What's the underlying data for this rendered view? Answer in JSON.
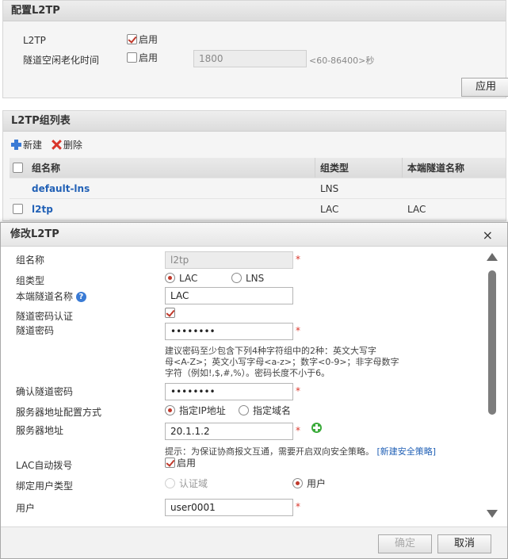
{
  "config": {
    "title": "配置L2TP",
    "l2tp_label": "L2TP",
    "l2tp_enable": "启用",
    "idle_label": "隧道空闲老化时间",
    "idle_enable": "启用",
    "idle_value": "1800",
    "idle_hint": "<60-86400>秒",
    "apply": "应用"
  },
  "group_list": {
    "title": "L2TP组列表",
    "new": "新建",
    "delete": "删除",
    "columns": [
      "组名称",
      "组类型",
      "本端隧道名称"
    ],
    "rows": [
      {
        "name": "default-lns",
        "type": "LNS",
        "tunnel": ""
      },
      {
        "name": "l2tp",
        "type": "LAC",
        "tunnel": "LAC"
      }
    ]
  },
  "dialog": {
    "title": "修改L2TP",
    "close": "×",
    "group_name_label": "组名称",
    "group_name_value": "l2tp",
    "group_type_label": "组类型",
    "type_lac": "LAC",
    "type_lns": "LNS",
    "tunnel_name_label": "本端隧道名称",
    "tunnel_name_value": "LAC",
    "auth_label": "隧道密码认证",
    "password_label": "隧道密码",
    "password_value": "••••••••",
    "password_note_1": "建议密码至少包含下列4种字符组中的2种：英文大写字",
    "password_note_2": "母<A-Z>；英文小写字母<a-z>；数字<0-9>；非字母数字",
    "password_note_3": "字符（例如!,$,#,%）。密码长度不小于6。",
    "confirm_label": "确认隧道密码",
    "confirm_value": "••••••••",
    "addr_mode_label": "服务器地址配置方式",
    "addr_mode_ip": "指定IP地址",
    "addr_mode_domain": "指定域名",
    "server_label": "服务器地址",
    "server_value": "20.1.1.2",
    "server_note": "提示：为保证协商报文互通，需要开启双向安全策略。",
    "server_link": "[新建安全策略]",
    "auto_dial_label": "LAC自动拨号",
    "auto_dial_enable": "启用",
    "bind_label": "绑定用户类型",
    "bind_domain": "认证域",
    "bind_user": "用户",
    "user_label": "用户",
    "user_value": "user0001",
    "ok": "确定",
    "cancel": "取消",
    "star": "*"
  }
}
